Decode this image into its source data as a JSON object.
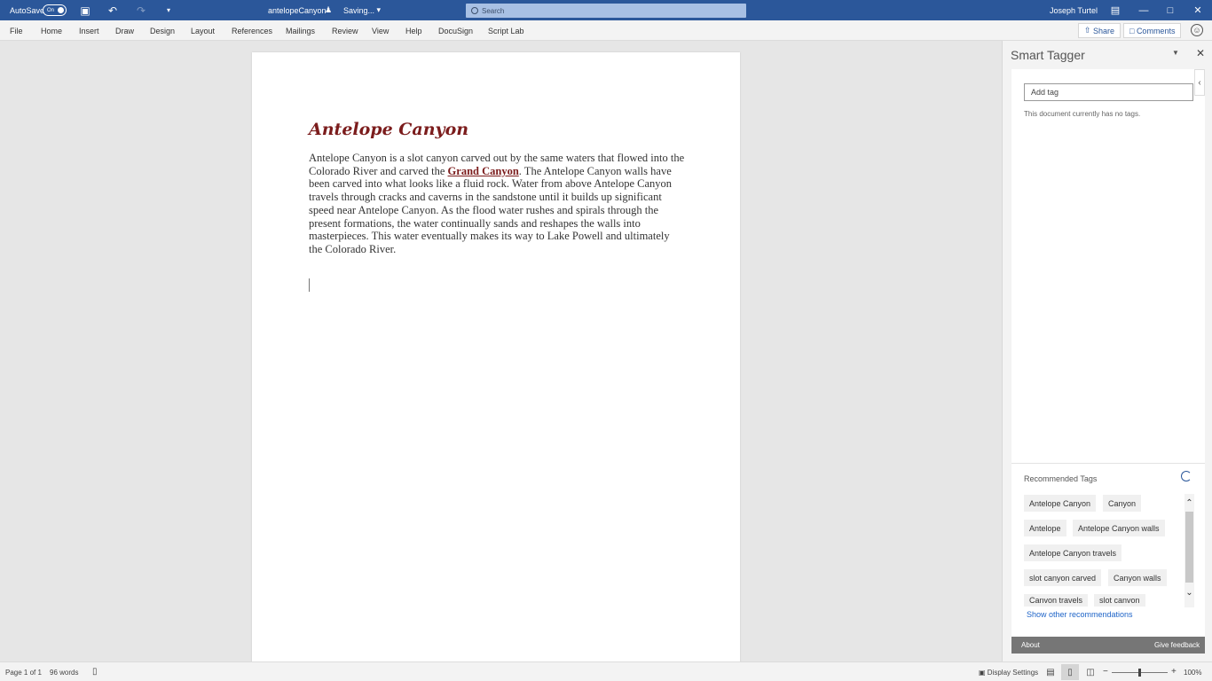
{
  "titlebar": {
    "autosave_label": "AutoSave",
    "autosave_state": "On",
    "doc_title": "antelopeCanyon",
    "doc_title_icon": "person-icon",
    "saving_status": "Saving...",
    "search_placeholder": "Search",
    "user_name": "Joseph Turtel"
  },
  "menu": {
    "items": [
      "File",
      "Home",
      "Insert",
      "Draw",
      "Design",
      "Layout",
      "References",
      "Mailings",
      "Review",
      "View",
      "Help",
      "DocuSign",
      "Script Lab"
    ],
    "share_label": "Share",
    "comments_label": "Comments"
  },
  "document": {
    "heading": "Antelope Canyon",
    "body_before": "Antelope Canyon is a slot canyon carved out by the same waters that flowed into the Colorado River and carved the ",
    "body_link": "Grand Canyon",
    "body_after": ". The Antelope Canyon walls have been carved into what looks like a fluid rock. Water from above Antelope Canyon travels through cracks and caverns in the sandstone until it builds up significant speed near Antelope Canyon. As the flood water rushes and spirals through the present formations, the water continually sands and reshapes the walls into masterpieces. This water eventually makes its way to Lake Powell and ultimately the Colorado River."
  },
  "pane": {
    "title": "Smart Tagger",
    "add_tag_placeholder": "Add tag",
    "no_tags_text": "This document currently has no tags.",
    "recommended_title": "Recommended Tags",
    "recommended_tags": [
      "Antelope Canyon",
      "Canyon",
      "Antelope",
      "Antelope Canyon walls",
      "Antelope Canyon travels",
      "slot canyon carved",
      "Canyon walls",
      "Canvon travels",
      "slot canvon"
    ],
    "show_other": "Show other recommendations",
    "about_label": "About",
    "feedback_label": "Give feedback"
  },
  "status": {
    "page": "Page 1 of 1",
    "words": "96 words",
    "display_settings": "Display Settings",
    "zoom": "100%"
  },
  "colors": {
    "titlebar_bg": "#2b579a",
    "heading": "#7b1c1c",
    "link": "#1e64c8"
  }
}
